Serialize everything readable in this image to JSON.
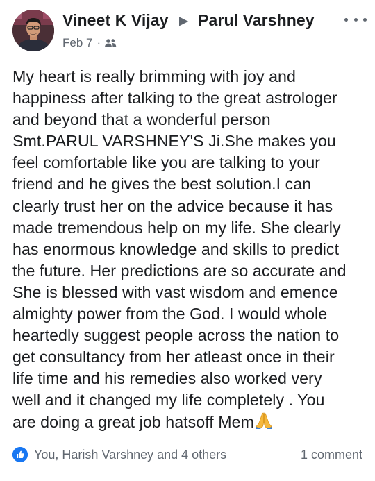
{
  "post": {
    "author": "Vineet K Vijay",
    "target": "Parul Varshney",
    "date": "Feb 7",
    "separator": "·",
    "audience_icon": "friends-icon",
    "more_icon": "more-options-icon",
    "text": "My heart is really brimming with joy and\nhappiness after talking to the great astrologer\nand beyond that a wonderful person\nSmt.PARUL VARSHNEY'S Ji.She makes you\nfeel comfortable like you are talking to your\nfriend and he gives the best solution.I can\nclearly trust her on the advice because it has\nmade tremendous help on my life. She clearly\nhas enormous knowledge and skills to predict\nthe future. Her predictions are so accurate and\nShe is blessed with vast wisdom and emence\nalmighty power from the God. I would whole\nheartedly suggest people across the nation to\nget consultancy from her atleast once in their\nlife time and his remedies also worked very\nwell and it changed my life completely .  You\nare doing a great job hatsoff Mem",
    "emoji": "folded-hands-emoji"
  },
  "footer": {
    "reaction_icon": "like-icon",
    "reactions_text": "You, Harish Varshney and 4 others",
    "comments_text": "1 comment"
  },
  "colors": {
    "primary_text": "#1c1e21",
    "secondary_text": "#606770",
    "like_blue": "#1877f2",
    "divider": "#dadde1"
  }
}
